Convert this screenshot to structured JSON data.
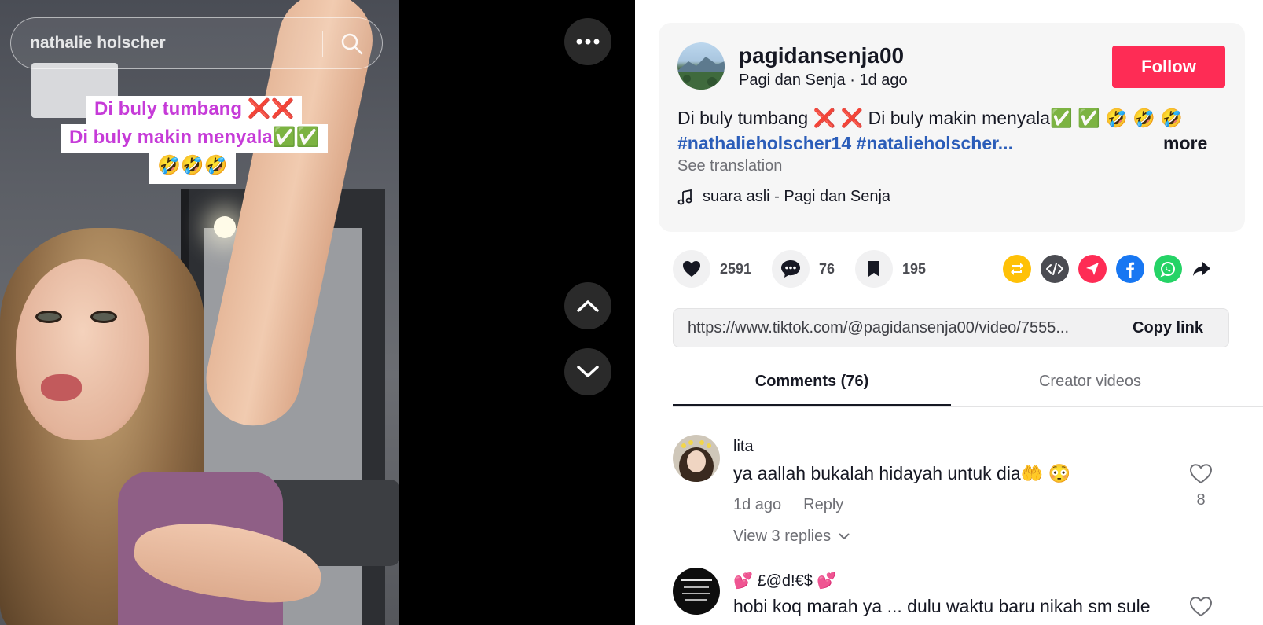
{
  "search": {
    "query": "nathalie holscher"
  },
  "video": {
    "captions": [
      "Di buly tumbang ❌❌",
      "Di buly makin menyala✅✅",
      "🤣🤣🤣"
    ],
    "icons": {
      "more": "more-dots-icon",
      "up": "chevron-up-icon",
      "down": "chevron-down-icon",
      "search": "search-icon"
    }
  },
  "post": {
    "username": "pagidansenja00",
    "display_name": "Pagi dan Senja",
    "separator": " · ",
    "time": "1d ago",
    "follow_label": "Follow",
    "description": "Di buly tumbang ❌ ❌ Di buly makin menyala✅ ✅  🤣 🤣 🤣",
    "hashtags": "#nathalieholscher14 #natalieholscher...",
    "more_label": "more",
    "see_translation": "See translation",
    "music": "suara asli - Pagi dan Senja"
  },
  "actions": {
    "likes": "2591",
    "comments": "76",
    "saves": "195",
    "share_colors": {
      "repost": "#ffc107",
      "embed": "#4b4c52",
      "send": "#fe2c55",
      "facebook": "#1877f2",
      "whatsapp": "#25d366"
    }
  },
  "link": {
    "url": "https://www.tiktok.com/@pagidansenja00/video/7555...",
    "copy_label": "Copy link"
  },
  "tabs": {
    "comments": "Comments (76)",
    "creator_videos": "Creator videos"
  },
  "comments": [
    {
      "user": "lita",
      "text": "ya aallah bukalah hidayah untuk dia🤲 😳",
      "time": "1d ago",
      "reply": "Reply",
      "likes": "8",
      "view_replies": "View 3 replies"
    },
    {
      "user": "💕 £@d!€$ 💕",
      "text": "hobi koq marah ya ... dulu waktu baru nikah sm sule"
    }
  ],
  "colors": {
    "accent": "#fe2c55",
    "hashtag": "#2b5db9",
    "caption": "#c63bd8"
  }
}
